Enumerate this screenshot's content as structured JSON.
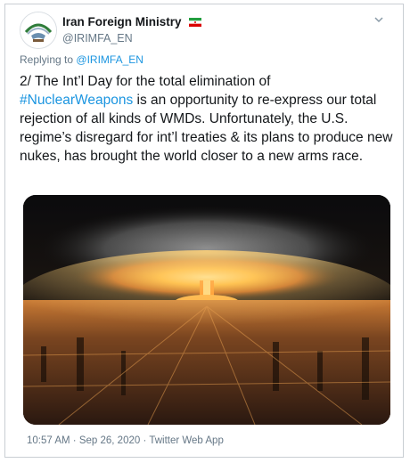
{
  "account": {
    "display_name": "Iran Foreign Ministry",
    "handle": "@IRIMFA_EN"
  },
  "reply": {
    "prefix": "Replying to",
    "mention": "@IRIMFA_EN"
  },
  "tweet": {
    "line1": "2/ The Int’l Day for the total elimination of",
    "hashtag": "#NuclearWeapons",
    "rest": " is an opportunity to re-express our total rejection of all kinds of WMDs. Unfortunately, the U.S. regime’s disregard for int’l treaties & its plans to produce new nukes, has brought the world closer to a new arms race."
  },
  "meta": {
    "time": "10:57 AM",
    "date": "Sep 26, 2020",
    "source": "Twitter Web App",
    "separator": "·"
  },
  "icons": {
    "avatar": "iran-foreign-ministry-avatar",
    "flag": "iran-flag-icon",
    "caret": "chevron-down-icon"
  },
  "colors": {
    "link": "#1b95e0",
    "secondary_text": "#657786",
    "primary_text": "#14171a",
    "border": "#c9ced3"
  }
}
